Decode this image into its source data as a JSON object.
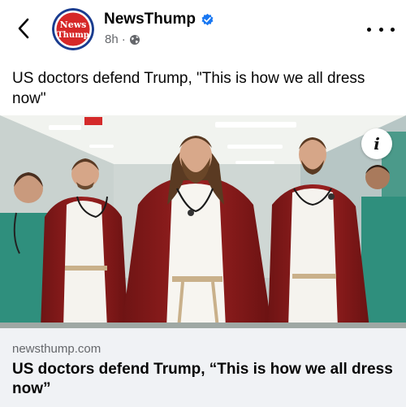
{
  "header": {
    "page_name": "NewsThump",
    "timestamp": "8h",
    "audience_icon": "globe-icon",
    "verified_icon": "verified-badge-icon",
    "back_icon": "chevron-left-icon",
    "more_icon": "more-options-icon",
    "avatar_logo_line1": "News",
    "avatar_logo_line2": "Thump",
    "avatar_colors": {
      "ring": "#1a3c8f",
      "inner": "#d62828",
      "text": "#ffffff"
    },
    "verified_color": "#1877f2",
    "separator": "·"
  },
  "post": {
    "text": "US doctors defend Trump, \"This is how we all dress now\""
  },
  "image": {
    "description_icon": "info-icon",
    "info_glyph": "i"
  },
  "link_preview": {
    "domain": "newsthump.com",
    "title": "US doctors defend Trump, “This is how we all dress now”",
    "background": "#f0f2f5"
  }
}
